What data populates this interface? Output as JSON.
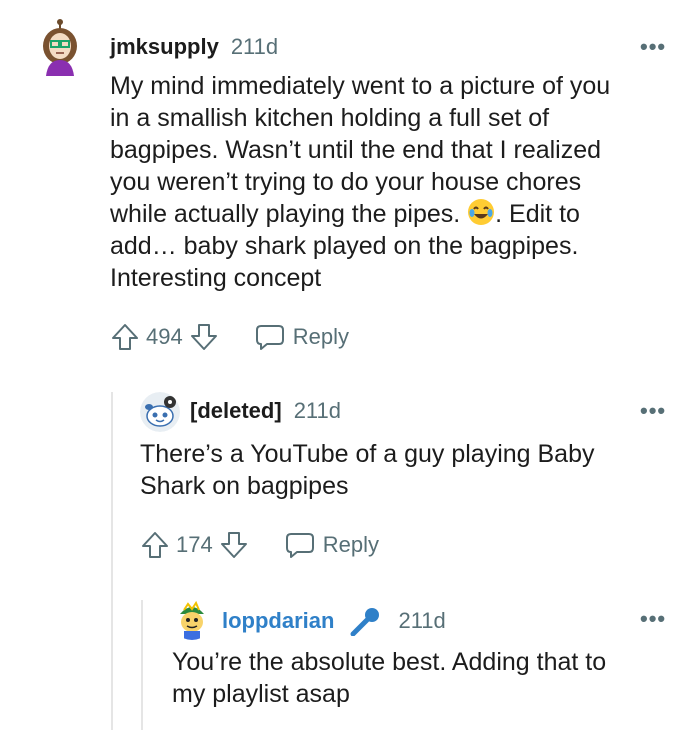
{
  "comments": [
    {
      "username": "jmksupply",
      "time": "211d",
      "more": "•••",
      "lines": [
        "My mind immediately went to a picture of you",
        "in a smallish kitchen holding a full set of",
        "bagpipes. Wasn’t until the end that I realized",
        "you weren’t trying to do your house chores",
        "while actually playing the pipes. ",
        ". Edit to",
        "add… baby shark played on the bagpipes.",
        "Interesting concept"
      ],
      "score": "494",
      "reply": "Reply"
    },
    {
      "username": "[deleted]",
      "time": "211d",
      "more": "•••",
      "lines": [
        "There’s a YouTube of a guy playing Baby",
        "Shark on bagpipes"
      ],
      "score": "174",
      "reply": "Reply"
    },
    {
      "username": "loppdarian",
      "time": "211d",
      "more": "•••",
      "lines": [
        "You’re the absolute best. Adding that to",
        "my playlist asap"
      ]
    }
  ],
  "colors": {
    "username_link": "#2f80c8",
    "meta": "#576f76",
    "thread_line": "#e5e5e5",
    "mic": "#2f80c8"
  }
}
